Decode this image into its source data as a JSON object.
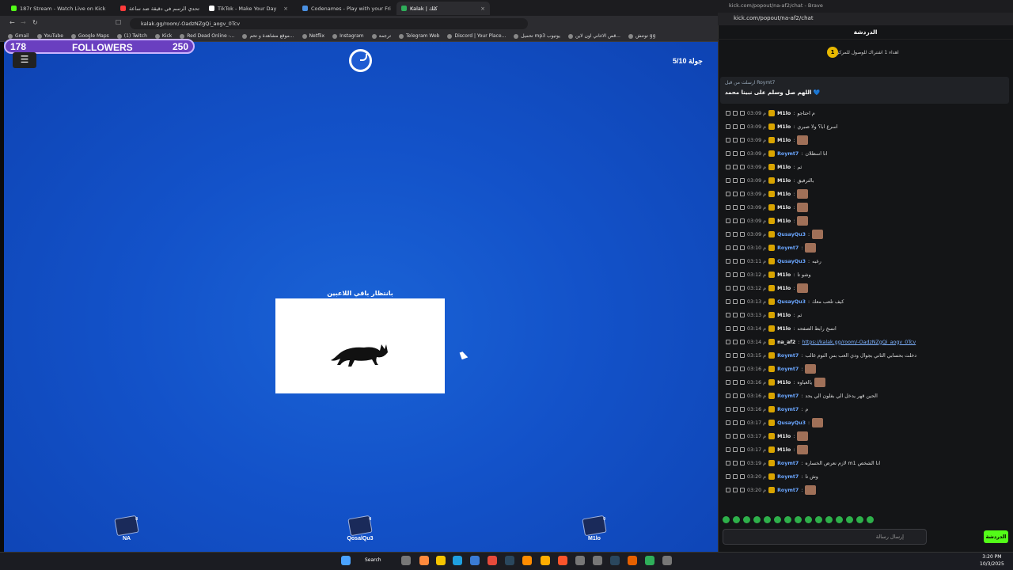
{
  "tabs": [
    {
      "label": "187r Stream - Watch Live on Kick",
      "color": "#53fc18"
    },
    {
      "label": "تحدي الرسم في دقيقة ضد ساعة",
      "color": "#ff3b3b"
    },
    {
      "label": "TikTok - Make Your Day",
      "color": "#ffffff"
    },
    {
      "label": "Codenames - Play with your Friends",
      "color": "#4a90e2"
    },
    {
      "label": "Kalak | كلك",
      "color": "#2fae5a"
    }
  ],
  "url": "kalak.gg/room/-OadzNZgQi_aogv_0Tcv",
  "bookmarks": [
    "Gmail",
    "YouTube",
    "Google Maps",
    "(1) Twitch",
    "Kick",
    "Red Dead Online -...",
    "موقع مشاهدة و تحم...",
    "Netflix",
    "Instagram",
    "ترجمة",
    "Telegram Web",
    "Discord | Your Place...",
    "تحميل mp3 يوتيوب",
    "قص الاغاني اون لاين...",
    "توتنش gg"
  ],
  "game": {
    "followers_label": "FOLLOWERS",
    "followers_current": "178",
    "followers_goal": "250",
    "menu_icon": "☰",
    "round": "جولة 5/10",
    "waiting_text": "بانتظار باقي اللاعبين",
    "players": [
      {
        "name": "NA",
        "badge": "8"
      },
      {
        "name": "QosalQu3",
        "badge": "4"
      },
      {
        "name": "M1lo",
        "badge": "0"
      }
    ]
  },
  "chat": {
    "window_title": "kick.com/popout/na-af2/chat - Brave",
    "url": "kick.com/popout/na-af2/chat",
    "header": "الدردشة",
    "sub_goal_count": "1",
    "sub_goal_text": "اهداء 1 اشتراك للوصول للمركز 1",
    "pinned_meta": "ارسلت من قبل Roymt7",
    "pinned_text": "اللهم صل وسلم على نبينا محمد 💙",
    "messages": [
      {
        "time": "03:09 م",
        "user": "M1lo",
        "text": "م احتاجو",
        "color": "#e9e9e9"
      },
      {
        "time": "03:09 م",
        "user": "M1lo",
        "text": "اسرع ابا؟ ولا صبري",
        "color": "#e9e9e9"
      },
      {
        "time": "03:09 م",
        "user": "M1lo",
        "text": "",
        "emote": true,
        "color": "#e9e9e9"
      },
      {
        "time": "03:09 م",
        "user": "Roymt7",
        "text": "انا اسطلان",
        "color": "#6aa6ff"
      },
      {
        "time": "03:09 م",
        "user": "M1lo",
        "text": "ثم",
        "color": "#e9e9e9"
      },
      {
        "time": "03:09 م",
        "user": "M1lo",
        "text": "بالترفيق",
        "color": "#e9e9e9"
      },
      {
        "time": "03:09 م",
        "user": "M1lo",
        "text": "",
        "emote": true,
        "color": "#e9e9e9"
      },
      {
        "time": "03:09 م",
        "user": "M1lo",
        "text": "",
        "emote": true,
        "color": "#e9e9e9"
      },
      {
        "time": "03:09 م",
        "user": "M1lo",
        "text": "",
        "emote": true,
        "color": "#e9e9e9"
      },
      {
        "time": "03:09 م",
        "user": "QusayQu3",
        "text": "",
        "emote": true,
        "color": "#6aa6ff"
      },
      {
        "time": "03:10 م",
        "user": "Roymt7",
        "text": "",
        "emote": true,
        "color": "#6aa6ff"
      },
      {
        "time": "03:11 م",
        "user": "QusayQu3",
        "text": "رغبه",
        "color": "#6aa6ff"
      },
      {
        "time": "03:12 م",
        "user": "M1lo",
        "text": "وشو تا",
        "color": "#e9e9e9"
      },
      {
        "time": "03:12 م",
        "user": "M1lo",
        "text": "",
        "emote": true,
        "color": "#e9e9e9"
      },
      {
        "time": "03:13 م",
        "user": "QusayQu3",
        "text": "كيف تلعب معك",
        "color": "#6aa6ff"
      },
      {
        "time": "03:13 م",
        "user": "M1lo",
        "text": "ثم",
        "color": "#e9e9e9"
      },
      {
        "time": "03:14 م",
        "user": "M1lo",
        "text": "انسخ رابط الصفحه",
        "color": "#e9e9e9"
      },
      {
        "time": "03:14 م",
        "user": "na_af2",
        "text": "https://kalak.gg/room/-OadzNZgQi_aogv_0Tcv",
        "link": true,
        "color": "#e9e9e9"
      },
      {
        "time": "03:15 م",
        "user": "Roymt7",
        "text": "دخلت بحسابي الثاني بجوال ودي العب بس النوم غالب",
        "color": "#6aa6ff"
      },
      {
        "time": "03:16 م",
        "user": "Roymt7",
        "text": "",
        "emote": true,
        "color": "#6aa6ff"
      },
      {
        "time": "03:16 م",
        "user": "M1lo",
        "text": "يالغباوه",
        "emote": true,
        "color": "#e9e9e9"
      },
      {
        "time": "03:16 م",
        "user": "Roymt7",
        "text": "الحين قهر يدخل الي بفلون الي يحد",
        "color": "#6aa6ff"
      },
      {
        "time": "03:16 م",
        "user": "Roymt7",
        "text": "م",
        "color": "#6aa6ff"
      },
      {
        "time": "03:17 م",
        "user": "QusayQu3",
        "text": "",
        "emote": true,
        "color": "#6aa6ff"
      },
      {
        "time": "03:17 م",
        "user": "M1lo",
        "text": "",
        "emote": true,
        "color": "#e9e9e9"
      },
      {
        "time": "03:17 م",
        "user": "M1lo",
        "text": "",
        "emote": true,
        "color": "#e9e9e9"
      },
      {
        "time": "03:19 م",
        "user": "Roymt7",
        "text": "لازم نعرض الخساره m1 انا الشخص",
        "color": "#6aa6ff"
      },
      {
        "time": "03:20 م",
        "user": "Roymt7",
        "text": "وش تا",
        "color": "#6aa6ff"
      },
      {
        "time": "03:20 م",
        "user": "Roymt7",
        "text": "",
        "emote": true,
        "color": "#6aa6ff"
      }
    ],
    "input_placeholder": "إرسال رسالة",
    "send_label": "الدردشة"
  },
  "taskbar": {
    "search": "Search",
    "time": "3:20 PM",
    "date": "10/3/2025"
  }
}
